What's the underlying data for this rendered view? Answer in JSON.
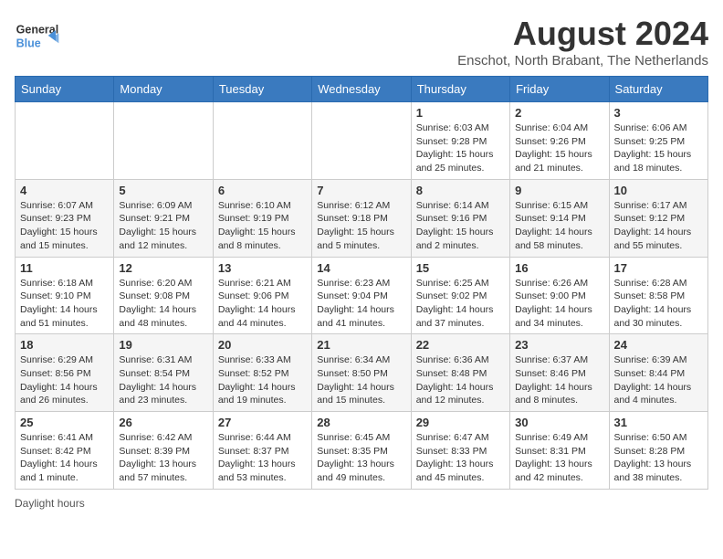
{
  "header": {
    "logo_general": "General",
    "logo_blue": "Blue",
    "main_title": "August 2024",
    "subtitle": "Enschot, North Brabant, The Netherlands"
  },
  "days_of_week": [
    "Sunday",
    "Monday",
    "Tuesday",
    "Wednesday",
    "Thursday",
    "Friday",
    "Saturday"
  ],
  "weeks": [
    [
      {
        "day": "",
        "info": ""
      },
      {
        "day": "",
        "info": ""
      },
      {
        "day": "",
        "info": ""
      },
      {
        "day": "",
        "info": ""
      },
      {
        "day": "1",
        "info": "Sunrise: 6:03 AM\nSunset: 9:28 PM\nDaylight: 15 hours\nand 25 minutes."
      },
      {
        "day": "2",
        "info": "Sunrise: 6:04 AM\nSunset: 9:26 PM\nDaylight: 15 hours\nand 21 minutes."
      },
      {
        "day": "3",
        "info": "Sunrise: 6:06 AM\nSunset: 9:25 PM\nDaylight: 15 hours\nand 18 minutes."
      }
    ],
    [
      {
        "day": "4",
        "info": "Sunrise: 6:07 AM\nSunset: 9:23 PM\nDaylight: 15 hours\nand 15 minutes."
      },
      {
        "day": "5",
        "info": "Sunrise: 6:09 AM\nSunset: 9:21 PM\nDaylight: 15 hours\nand 12 minutes."
      },
      {
        "day": "6",
        "info": "Sunrise: 6:10 AM\nSunset: 9:19 PM\nDaylight: 15 hours\nand 8 minutes."
      },
      {
        "day": "7",
        "info": "Sunrise: 6:12 AM\nSunset: 9:18 PM\nDaylight: 15 hours\nand 5 minutes."
      },
      {
        "day": "8",
        "info": "Sunrise: 6:14 AM\nSunset: 9:16 PM\nDaylight: 15 hours\nand 2 minutes."
      },
      {
        "day": "9",
        "info": "Sunrise: 6:15 AM\nSunset: 9:14 PM\nDaylight: 14 hours\nand 58 minutes."
      },
      {
        "day": "10",
        "info": "Sunrise: 6:17 AM\nSunset: 9:12 PM\nDaylight: 14 hours\nand 55 minutes."
      }
    ],
    [
      {
        "day": "11",
        "info": "Sunrise: 6:18 AM\nSunset: 9:10 PM\nDaylight: 14 hours\nand 51 minutes."
      },
      {
        "day": "12",
        "info": "Sunrise: 6:20 AM\nSunset: 9:08 PM\nDaylight: 14 hours\nand 48 minutes."
      },
      {
        "day": "13",
        "info": "Sunrise: 6:21 AM\nSunset: 9:06 PM\nDaylight: 14 hours\nand 44 minutes."
      },
      {
        "day": "14",
        "info": "Sunrise: 6:23 AM\nSunset: 9:04 PM\nDaylight: 14 hours\nand 41 minutes."
      },
      {
        "day": "15",
        "info": "Sunrise: 6:25 AM\nSunset: 9:02 PM\nDaylight: 14 hours\nand 37 minutes."
      },
      {
        "day": "16",
        "info": "Sunrise: 6:26 AM\nSunset: 9:00 PM\nDaylight: 14 hours\nand 34 minutes."
      },
      {
        "day": "17",
        "info": "Sunrise: 6:28 AM\nSunset: 8:58 PM\nDaylight: 14 hours\nand 30 minutes."
      }
    ],
    [
      {
        "day": "18",
        "info": "Sunrise: 6:29 AM\nSunset: 8:56 PM\nDaylight: 14 hours\nand 26 minutes."
      },
      {
        "day": "19",
        "info": "Sunrise: 6:31 AM\nSunset: 8:54 PM\nDaylight: 14 hours\nand 23 minutes."
      },
      {
        "day": "20",
        "info": "Sunrise: 6:33 AM\nSunset: 8:52 PM\nDaylight: 14 hours\nand 19 minutes."
      },
      {
        "day": "21",
        "info": "Sunrise: 6:34 AM\nSunset: 8:50 PM\nDaylight: 14 hours\nand 15 minutes."
      },
      {
        "day": "22",
        "info": "Sunrise: 6:36 AM\nSunset: 8:48 PM\nDaylight: 14 hours\nand 12 minutes."
      },
      {
        "day": "23",
        "info": "Sunrise: 6:37 AM\nSunset: 8:46 PM\nDaylight: 14 hours\nand 8 minutes."
      },
      {
        "day": "24",
        "info": "Sunrise: 6:39 AM\nSunset: 8:44 PM\nDaylight: 14 hours\nand 4 minutes."
      }
    ],
    [
      {
        "day": "25",
        "info": "Sunrise: 6:41 AM\nSunset: 8:42 PM\nDaylight: 14 hours\nand 1 minute."
      },
      {
        "day": "26",
        "info": "Sunrise: 6:42 AM\nSunset: 8:39 PM\nDaylight: 13 hours\nand 57 minutes."
      },
      {
        "day": "27",
        "info": "Sunrise: 6:44 AM\nSunset: 8:37 PM\nDaylight: 13 hours\nand 53 minutes."
      },
      {
        "day": "28",
        "info": "Sunrise: 6:45 AM\nSunset: 8:35 PM\nDaylight: 13 hours\nand 49 minutes."
      },
      {
        "day": "29",
        "info": "Sunrise: 6:47 AM\nSunset: 8:33 PM\nDaylight: 13 hours\nand 45 minutes."
      },
      {
        "day": "30",
        "info": "Sunrise: 6:49 AM\nSunset: 8:31 PM\nDaylight: 13 hours\nand 42 minutes."
      },
      {
        "day": "31",
        "info": "Sunrise: 6:50 AM\nSunset: 8:28 PM\nDaylight: 13 hours\nand 38 minutes."
      }
    ]
  ],
  "footer": {
    "note": "Daylight hours"
  }
}
